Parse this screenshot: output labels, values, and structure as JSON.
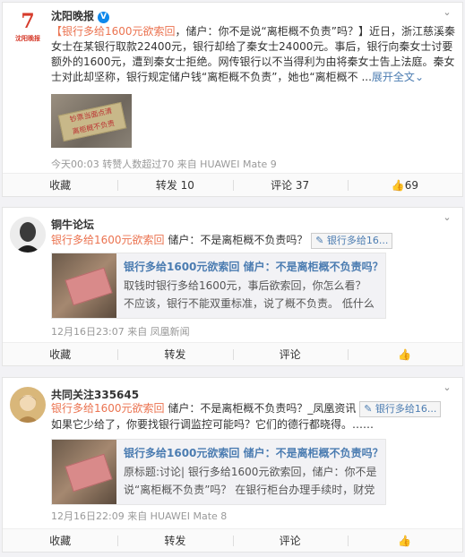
{
  "posts": [
    {
      "author": "沈阳晚报",
      "logo_text": "沈阳晚报",
      "text_topic": "【银行多给1600元欲索回",
      "text_body": "，储户：你不是说“离柜概不负责”吗？】近日，浙江慈溪秦女士在某银行取款22400元，银行却给了秦女士24000元。事后，银行向秦女士讨要额外的1600元，遭到秦女士拒绝。网传银行以不当得利为由将秦女士告上法庭。秦女士对此却坚称，银行规定储户钱“离柜概不负责”，她也“离柜概不 ...",
      "expand": "展开全文",
      "image_sign_line1": "钞票当面点清",
      "image_sign_line2": "离柜概不负责",
      "meta": "今天00:03 转赞人数超过70 来自 HUAWEI Mate 9",
      "actions": {
        "fav": "收藏",
        "repost": "转发 10",
        "comment": "评论 37",
        "like": "69"
      }
    },
    {
      "author": "铜牛论坛",
      "text_topic": "银行多给1600元欲索回",
      "text_body": " 储户：不是离柜概不负责吗？",
      "tag": "银行多给16...",
      "share_title": "银行多给1600元欲索回 储户：不是离柜概不负责吗？",
      "share_desc": "取钱时银行多给1600元，事后欲索回，你怎么看？ 不应该，银行不能双重标准，说了概不负责。 低什么问",
      "meta": "12月16日23:07 来自 凤凰新闻",
      "actions": {
        "fav": "收藏",
        "repost": "转发",
        "comment": "评论",
        "like": ""
      }
    },
    {
      "author": "共同关注335645",
      "text_topic": "银行多给1600元欲索回",
      "text_body": " 储户：不是离柜概不负责吗？_凤凰资讯 ",
      "tag": "银行多给16...",
      "text_line2": "如果它少给了，你要找银行调监控可能吗？它们的德行都晓得。……",
      "share_title": "银行多给1600元欲索回 储户：不是离柜概不负责吗？",
      "share_desc": "原标题:讨论| 银行多给1600元欲索回，储户：你不是说“离柜概不负责”吗？ 在银行柜台办理手续时，财党",
      "meta": "12月16日22:09 来自 HUAWEI Mate 8",
      "actions": {
        "fav": "收藏",
        "repost": "转发",
        "comment": "评论",
        "like": ""
      }
    }
  ]
}
